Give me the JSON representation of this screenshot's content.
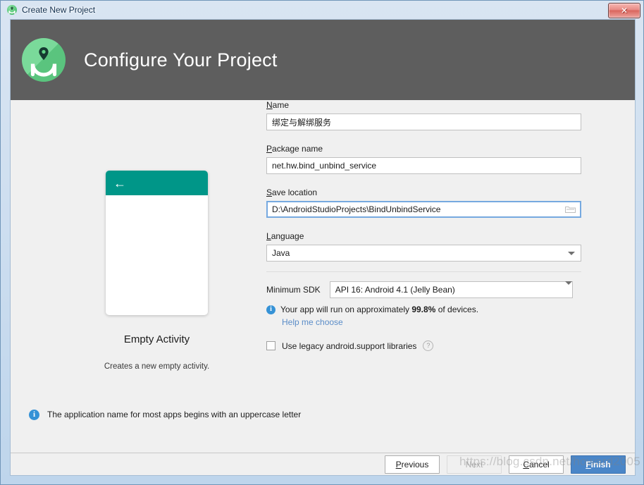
{
  "window": {
    "title": "Create New Project",
    "title_icon": "android-studio-icon",
    "close_label": "✕"
  },
  "banner": {
    "heading": "Configure Your Project",
    "logo": "android-studio-logo",
    "background": "#5e5e5e"
  },
  "preview": {
    "template_name": "Empty Activity",
    "description": "Creates a new empty activity.",
    "appbar_color": "#009688",
    "back_arrow": "←"
  },
  "form": {
    "name": {
      "label_accel": "N",
      "label_rest": "ame",
      "value": "绑定与解绑服务"
    },
    "package": {
      "label_accel": "P",
      "label_rest": "ackage name",
      "value": "net.hw.bind_unbind_service"
    },
    "save_location": {
      "label_accel": "S",
      "label_rest": "ave location",
      "value": "D:\\AndroidStudioProjects\\BindUnbindService",
      "browse_icon": "folder-icon",
      "focused": true
    },
    "language": {
      "label_accel": "L",
      "label_rest": "anguage",
      "value": "Java"
    },
    "minimum_sdk": {
      "label": "Minimum SDK",
      "value": "API 16: Android 4.1 (Jelly Bean)"
    },
    "device_coverage": {
      "prefix": "Your app will run on approximately ",
      "percent": "99.8%",
      "suffix": " of devices.",
      "help_link": "Help me choose"
    },
    "legacy_checkbox": {
      "label": "Use legacy android.support libraries",
      "checked": false,
      "help_icon": "?"
    }
  },
  "validation": {
    "message": "The application name for most apps begins with an uppercase letter",
    "icon": "info-icon"
  },
  "buttons": {
    "previous": {
      "accel": "P",
      "rest": "revious"
    },
    "next": {
      "accel": "",
      "rest": "Next",
      "disabled": true
    },
    "cancel": {
      "accel": "C",
      "rest": "ancel"
    },
    "finish": {
      "accel": "F",
      "rest": "inish",
      "color": "#4a86c8"
    }
  },
  "watermark": {
    "text": "https://blog.csdn.net/howard2005"
  }
}
